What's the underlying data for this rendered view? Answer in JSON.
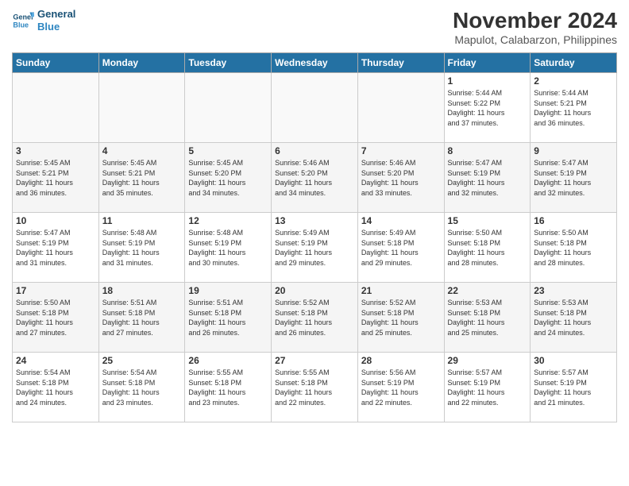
{
  "header": {
    "logo_line1": "General",
    "logo_line2": "Blue",
    "month": "November 2024",
    "location": "Mapulot, Calabarzon, Philippines"
  },
  "weekdays": [
    "Sunday",
    "Monday",
    "Tuesday",
    "Wednesday",
    "Thursday",
    "Friday",
    "Saturday"
  ],
  "weeks": [
    [
      {
        "day": "",
        "info": ""
      },
      {
        "day": "",
        "info": ""
      },
      {
        "day": "",
        "info": ""
      },
      {
        "day": "",
        "info": ""
      },
      {
        "day": "",
        "info": ""
      },
      {
        "day": "1",
        "info": "Sunrise: 5:44 AM\nSunset: 5:22 PM\nDaylight: 11 hours\nand 37 minutes."
      },
      {
        "day": "2",
        "info": "Sunrise: 5:44 AM\nSunset: 5:21 PM\nDaylight: 11 hours\nand 36 minutes."
      }
    ],
    [
      {
        "day": "3",
        "info": "Sunrise: 5:45 AM\nSunset: 5:21 PM\nDaylight: 11 hours\nand 36 minutes."
      },
      {
        "day": "4",
        "info": "Sunrise: 5:45 AM\nSunset: 5:21 PM\nDaylight: 11 hours\nand 35 minutes."
      },
      {
        "day": "5",
        "info": "Sunrise: 5:45 AM\nSunset: 5:20 PM\nDaylight: 11 hours\nand 34 minutes."
      },
      {
        "day": "6",
        "info": "Sunrise: 5:46 AM\nSunset: 5:20 PM\nDaylight: 11 hours\nand 34 minutes."
      },
      {
        "day": "7",
        "info": "Sunrise: 5:46 AM\nSunset: 5:20 PM\nDaylight: 11 hours\nand 33 minutes."
      },
      {
        "day": "8",
        "info": "Sunrise: 5:47 AM\nSunset: 5:19 PM\nDaylight: 11 hours\nand 32 minutes."
      },
      {
        "day": "9",
        "info": "Sunrise: 5:47 AM\nSunset: 5:19 PM\nDaylight: 11 hours\nand 32 minutes."
      }
    ],
    [
      {
        "day": "10",
        "info": "Sunrise: 5:47 AM\nSunset: 5:19 PM\nDaylight: 11 hours\nand 31 minutes."
      },
      {
        "day": "11",
        "info": "Sunrise: 5:48 AM\nSunset: 5:19 PM\nDaylight: 11 hours\nand 31 minutes."
      },
      {
        "day": "12",
        "info": "Sunrise: 5:48 AM\nSunset: 5:19 PM\nDaylight: 11 hours\nand 30 minutes."
      },
      {
        "day": "13",
        "info": "Sunrise: 5:49 AM\nSunset: 5:19 PM\nDaylight: 11 hours\nand 29 minutes."
      },
      {
        "day": "14",
        "info": "Sunrise: 5:49 AM\nSunset: 5:18 PM\nDaylight: 11 hours\nand 29 minutes."
      },
      {
        "day": "15",
        "info": "Sunrise: 5:50 AM\nSunset: 5:18 PM\nDaylight: 11 hours\nand 28 minutes."
      },
      {
        "day": "16",
        "info": "Sunrise: 5:50 AM\nSunset: 5:18 PM\nDaylight: 11 hours\nand 28 minutes."
      }
    ],
    [
      {
        "day": "17",
        "info": "Sunrise: 5:50 AM\nSunset: 5:18 PM\nDaylight: 11 hours\nand 27 minutes."
      },
      {
        "day": "18",
        "info": "Sunrise: 5:51 AM\nSunset: 5:18 PM\nDaylight: 11 hours\nand 27 minutes."
      },
      {
        "day": "19",
        "info": "Sunrise: 5:51 AM\nSunset: 5:18 PM\nDaylight: 11 hours\nand 26 minutes."
      },
      {
        "day": "20",
        "info": "Sunrise: 5:52 AM\nSunset: 5:18 PM\nDaylight: 11 hours\nand 26 minutes."
      },
      {
        "day": "21",
        "info": "Sunrise: 5:52 AM\nSunset: 5:18 PM\nDaylight: 11 hours\nand 25 minutes."
      },
      {
        "day": "22",
        "info": "Sunrise: 5:53 AM\nSunset: 5:18 PM\nDaylight: 11 hours\nand 25 minutes."
      },
      {
        "day": "23",
        "info": "Sunrise: 5:53 AM\nSunset: 5:18 PM\nDaylight: 11 hours\nand 24 minutes."
      }
    ],
    [
      {
        "day": "24",
        "info": "Sunrise: 5:54 AM\nSunset: 5:18 PM\nDaylight: 11 hours\nand 24 minutes."
      },
      {
        "day": "25",
        "info": "Sunrise: 5:54 AM\nSunset: 5:18 PM\nDaylight: 11 hours\nand 23 minutes."
      },
      {
        "day": "26",
        "info": "Sunrise: 5:55 AM\nSunset: 5:18 PM\nDaylight: 11 hours\nand 23 minutes."
      },
      {
        "day": "27",
        "info": "Sunrise: 5:55 AM\nSunset: 5:18 PM\nDaylight: 11 hours\nand 22 minutes."
      },
      {
        "day": "28",
        "info": "Sunrise: 5:56 AM\nSunset: 5:19 PM\nDaylight: 11 hours\nand 22 minutes."
      },
      {
        "day": "29",
        "info": "Sunrise: 5:57 AM\nSunset: 5:19 PM\nDaylight: 11 hours\nand 22 minutes."
      },
      {
        "day": "30",
        "info": "Sunrise: 5:57 AM\nSunset: 5:19 PM\nDaylight: 11 hours\nand 21 minutes."
      }
    ]
  ]
}
